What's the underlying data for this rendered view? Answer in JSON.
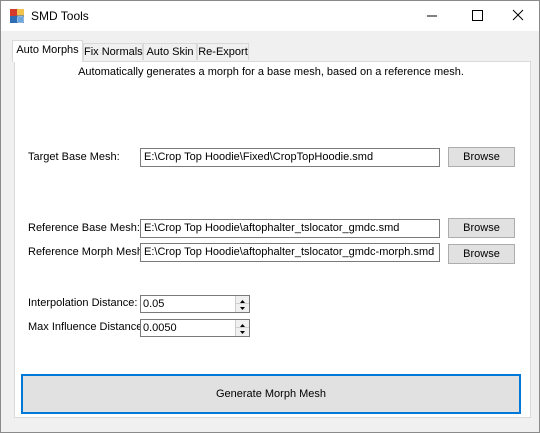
{
  "window": {
    "title": "SMD Tools",
    "controls": {
      "minimize_icon": "minimize-icon",
      "maximize_icon": "maximize-icon",
      "close_icon": "close-icon"
    }
  },
  "tabs": [
    {
      "label": "Auto Morphs",
      "active": true
    },
    {
      "label": "Fix Normals",
      "active": false
    },
    {
      "label": "Auto Skin",
      "active": false
    },
    {
      "label": "Re-Export",
      "active": false
    }
  ],
  "auto_morphs": {
    "description": "Automatically generates a morph for a base mesh, based on a reference mesh.",
    "target_base_mesh": {
      "label": "Target Base Mesh:",
      "value": "E:\\Crop Top Hoodie\\Fixed\\CropTopHoodie.smd",
      "browse_label": "Browse"
    },
    "reference_base_mesh": {
      "label": "Reference Base Mesh:",
      "value": "E:\\Crop Top Hoodie\\aftophalter_tslocator_gmdc.smd",
      "browse_label": "Browse"
    },
    "reference_morph_mesh": {
      "label": "Reference Morph Mesh:",
      "value": "E:\\Crop Top Hoodie\\aftophalter_tslocator_gmdc-morph.smd",
      "browse_label": "Browse"
    },
    "interpolation_distance": {
      "label": "Interpolation Distance:",
      "value": "0.05"
    },
    "max_influence_distance": {
      "label": "Max Influence Distance:",
      "value": "0.0050"
    },
    "generate_label": "Generate Morph Mesh"
  },
  "colors": {
    "accent": "#0078d7",
    "button_face": "#e1e1e1",
    "window_bg": "#f0f0f0"
  }
}
